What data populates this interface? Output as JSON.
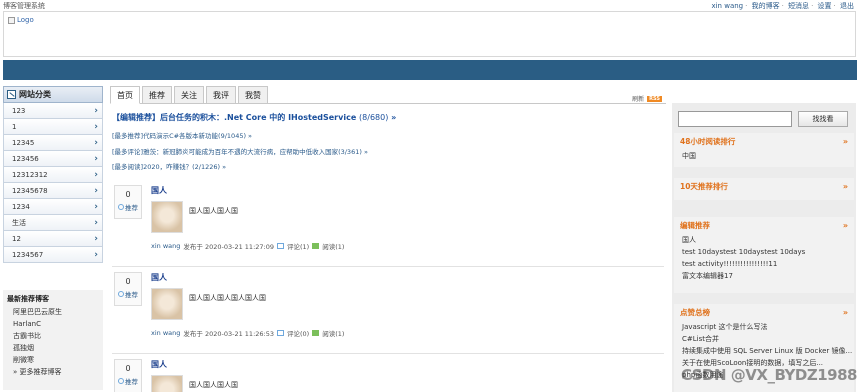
{
  "header": {
    "site_title": "博客管理系统",
    "links": [
      "xin wang",
      "我的博客",
      "短消息",
      "设置",
      "退出"
    ]
  },
  "logo": {
    "alt": "Logo"
  },
  "left": {
    "category_title": "网站分类",
    "categories": [
      "123",
      "1",
      "12345",
      "123456",
      "12312312",
      "12345678",
      "1234",
      "生活",
      "12",
      "1234567"
    ],
    "recommend_title": "最新推荐博客",
    "recommend_items": [
      "阿里巴巴云原生",
      "HarlanC",
      "古霸书比",
      "孤独烟",
      "削微寒",
      "» 更多推荐博客"
    ]
  },
  "main": {
    "tabs": [
      "首页",
      "推荐",
      "关注",
      "我评",
      "我赞"
    ],
    "refresh": "刷新",
    "rss": "RSS",
    "headline": "【编辑推荐】后台任务的积木：.Net Core 中的 IHostedService",
    "headline_count": "(8/680)",
    "headline_more": "»",
    "sublinks": [
      "[最多推荐]代码演示C#各版本新功能(9/1045) »",
      "[最多评论]雅茨：新冠肺炎可能成为百年不遇的大流行病，应帮助中低收入国家(3/361) »",
      "[最多阅读]2020，咋赚钱？(2/1226) »"
    ],
    "posts": [
      {
        "votes": "0",
        "vote_label": "推荐",
        "title": "国人",
        "body": "国人国人国人国",
        "author": "xin wang",
        "published": "发布于 2020-03-21 11:27:09",
        "comments": "评论(1)",
        "reads": "阅读(1)"
      },
      {
        "votes": "0",
        "vote_label": "推荐",
        "title": "国人",
        "body": "国人国人国人国人国人国",
        "author": "xin wang",
        "published": "发布于 2020-03-21 11:26:53",
        "comments": "评论(0)",
        "reads": "阅读(1)"
      },
      {
        "votes": "0",
        "vote_label": "推荐",
        "title": "国人",
        "body": "国人国人国人国",
        "author": "",
        "published": "",
        "comments": "",
        "reads": ""
      }
    ]
  },
  "right": {
    "search_button": "找找看",
    "sections": [
      {
        "title": "48小时阅读排行",
        "items": [
          "中国"
        ]
      },
      {
        "title": "10天推荐排行",
        "items": []
      },
      {
        "title": "编辑推荐",
        "items": [
          "国人",
          "test 10daystest 10daystest 10days",
          "test activity!!!!!!!!!!!!!!!!11",
          "富文本编辑器17"
        ]
      },
      {
        "title": "点赞总榜",
        "items": [
          "Javascript 这个是什么写法",
          "C#List合并",
          "持续集成中使用 SQL Server Linux 版 Docker 镜像...",
          "关于在使用ScoLoon接明的数据，填写之后...",
          "php函数用途"
        ]
      }
    ]
  },
  "watermark": "CSDN @VX_BYDZ1988",
  "colors": {
    "nav": "#2a5d84",
    "accent": "#e0721c",
    "link": "#1a4f9c"
  }
}
